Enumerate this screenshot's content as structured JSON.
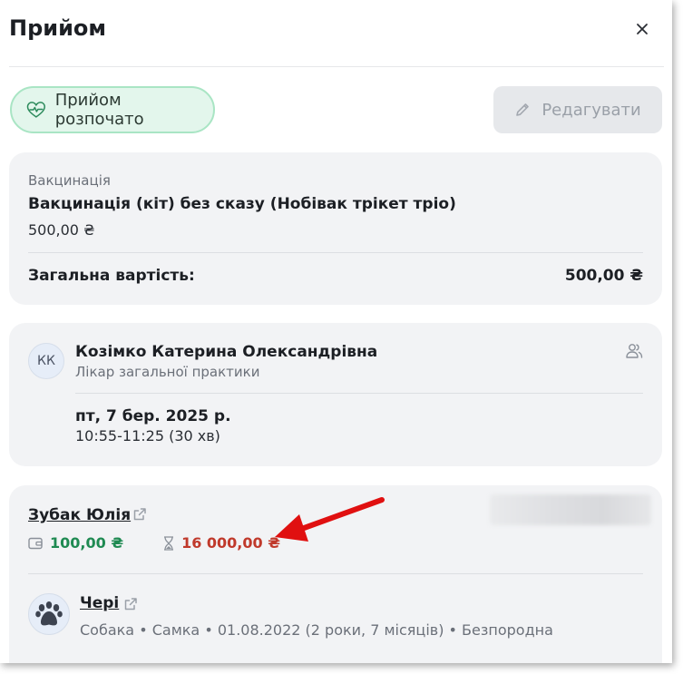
{
  "dialog": {
    "title": "Прийом",
    "close_icon": "close-icon"
  },
  "actions": {
    "status_label": "Прийом розпочато",
    "status_icon": "heartbeat-icon",
    "edit_label": "Редагувати",
    "edit_icon": "pencil-icon"
  },
  "service": {
    "category": "Вакцинація",
    "name": "Вакцинація (кіт) без сказу (Нобівак трікет тріо)",
    "price": "500,00 ₴",
    "total_label": "Загальна вартість:",
    "total_value": "500,00 ₴"
  },
  "doctor": {
    "initials": "КК",
    "name": "Козімко Катерина Олександрівна",
    "role": "Лікар загальної практики",
    "date": "пт, 7 бер. 2025 р.",
    "time": "10:55-11:25 (30 хв)"
  },
  "client": {
    "name": "Зубак Юлія",
    "balance": "100,00 ₴",
    "debt": "16 000,00 ₴"
  },
  "pet": {
    "name": "Чері",
    "info": "Собака • Самка • 01.08.2022 (2 роки, 7 місяців) • Безпородна"
  },
  "colors": {
    "balance": "#1f8a52",
    "debt": "#c0392b",
    "status_bg": "#e3f6ec",
    "annotation_arrow": "#e01010"
  }
}
